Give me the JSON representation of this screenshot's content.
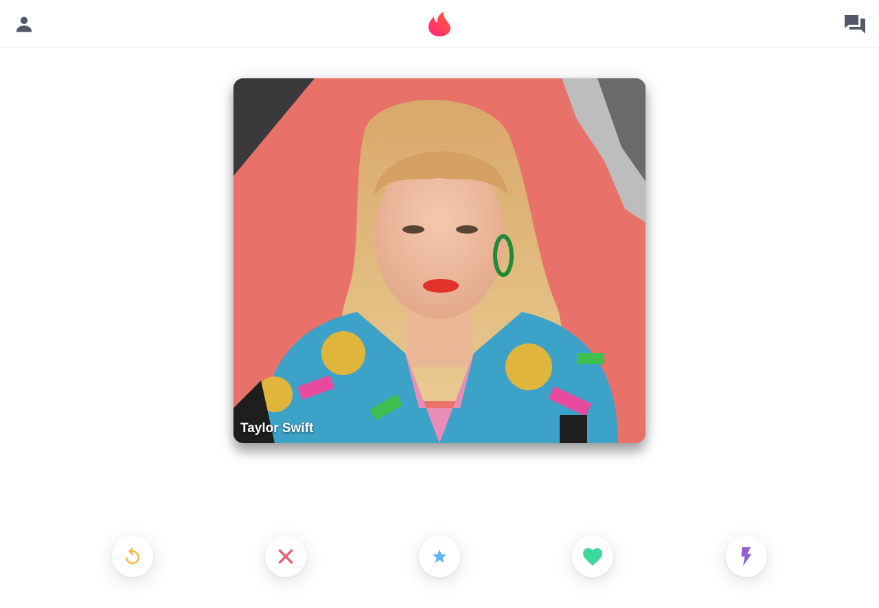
{
  "header": {
    "profile_icon": "person-icon",
    "logo_icon": "flame-logo-icon",
    "messages_icon": "chat-bubbles-icon",
    "icon_color": "#505965"
  },
  "card": {
    "name": "Taylor Swift",
    "image": "profile-photo"
  },
  "actions": [
    {
      "icon": "rewind-icon",
      "color": "#f5b748"
    },
    {
      "icon": "close-icon",
      "color": "#ec5e6f"
    },
    {
      "icon": "star-icon",
      "color": "#62b4f0"
    },
    {
      "icon": "heart-icon",
      "color": "#3ad99b"
    },
    {
      "icon": "bolt-icon",
      "color": "#915dd1"
    }
  ],
  "colors": {
    "brand_gradient_start": "#fd267a",
    "brand_gradient_end": "#ff6036",
    "card_background": "#e8716a"
  }
}
